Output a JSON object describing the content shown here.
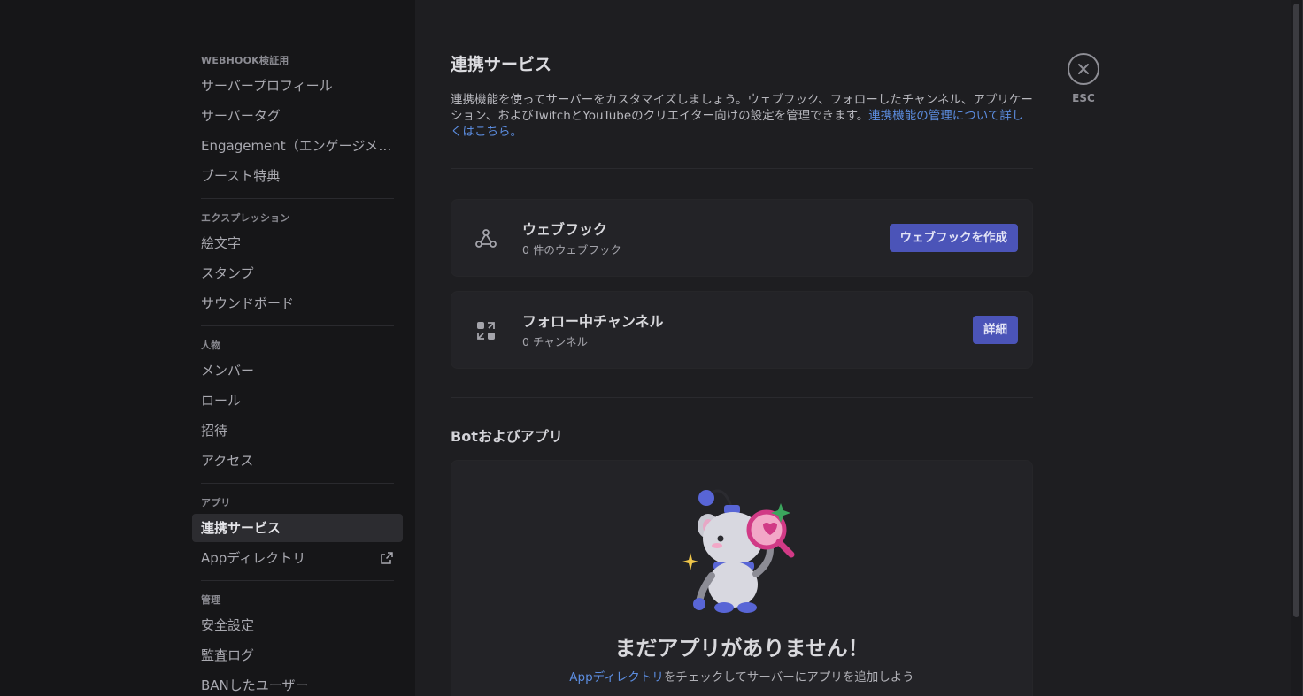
{
  "sidebar": {
    "sections": [
      {
        "header": "WEBHOOK検証用",
        "items": [
          "サーバープロフィール",
          "サーバータグ",
          "Engagement（エンゲージメント）",
          "ブースト特典"
        ]
      },
      {
        "header": "エクスプレッション",
        "items": [
          "絵文字",
          "スタンプ",
          "サウンドボード"
        ]
      },
      {
        "header": "人物",
        "items": [
          "メンバー",
          "ロール",
          "招待",
          "アクセス"
        ]
      },
      {
        "header": "アプリ",
        "items": [
          "連携サービス",
          "Appディレクトリ"
        ]
      },
      {
        "header": "管理",
        "items": [
          "安全設定",
          "監査ログ",
          "BANしたユーザー"
        ]
      }
    ],
    "selected": "連携サービス"
  },
  "main": {
    "title": "連携サービス",
    "description": "連携機能を使ってサーバーをカスタマイズしましょう。ウェブフック、フォローしたチャンネル、アプリケーション、およびTwitchとYouTubeのクリエイター向けの設定を管理できます。",
    "description_link": "連携機能の管理について詳しくはこちら。",
    "webhooks": {
      "title": "ウェブフック",
      "subtitle": "0 件のウェブフック",
      "button": "ウェブフックを作成",
      "icon": "webhook-icon"
    },
    "followed": {
      "title": "フォロー中チャンネル",
      "subtitle": "0 チャンネル",
      "button": "詳細",
      "icon": "follow-channel-icon"
    },
    "apps_section": {
      "title": "Botおよびアプリ",
      "empty_title": "まだアプリがありません！",
      "empty_link": "Appディレクトリ",
      "empty_desc": "をチェックしてサーバーにアプリを追加しよう"
    }
  },
  "close": {
    "label": "ESC",
    "icon": "close-icon"
  },
  "colors": {
    "accent": "#4b54b8",
    "link": "#5c8de0",
    "sidebar_bg": "#161618",
    "main_bg": "#1e1e21"
  }
}
